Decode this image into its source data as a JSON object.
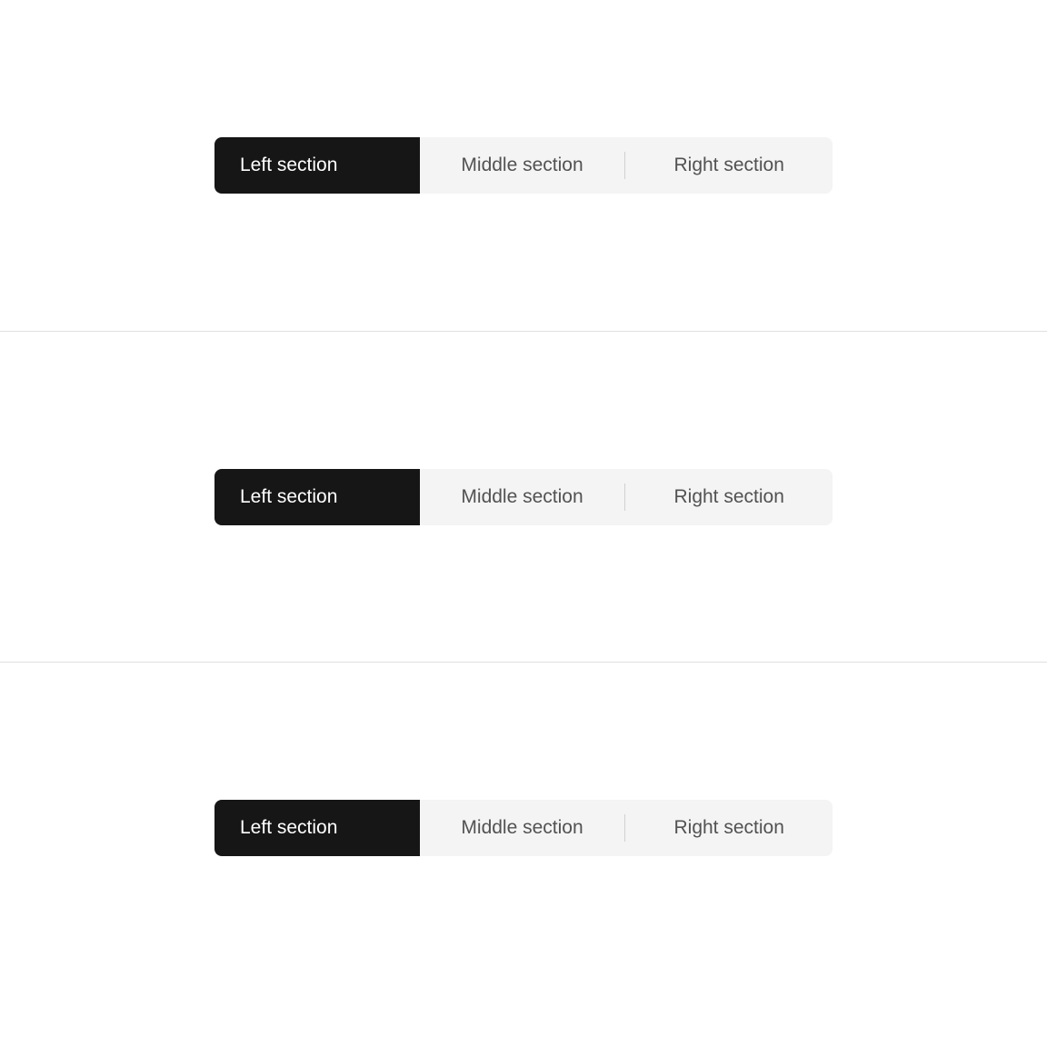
{
  "examples": [
    {
      "segments": {
        "left": "Left section",
        "middle": "Middle section",
        "right": "Right section"
      },
      "selected": "left"
    },
    {
      "segments": {
        "left": "Left section",
        "middle": "Middle section",
        "right": "Right section"
      },
      "selected": "left"
    },
    {
      "segments": {
        "left": "Left section",
        "middle": "Middle section",
        "right": "Right section"
      },
      "selected": "left"
    }
  ],
  "colors": {
    "background": "#4a7a4e",
    "selected_bg": "#161616",
    "selected_text": "#ffffff",
    "unselected_bg": "#f4f4f4",
    "unselected_text": "#525252",
    "divider": "#d0d0d0"
  }
}
